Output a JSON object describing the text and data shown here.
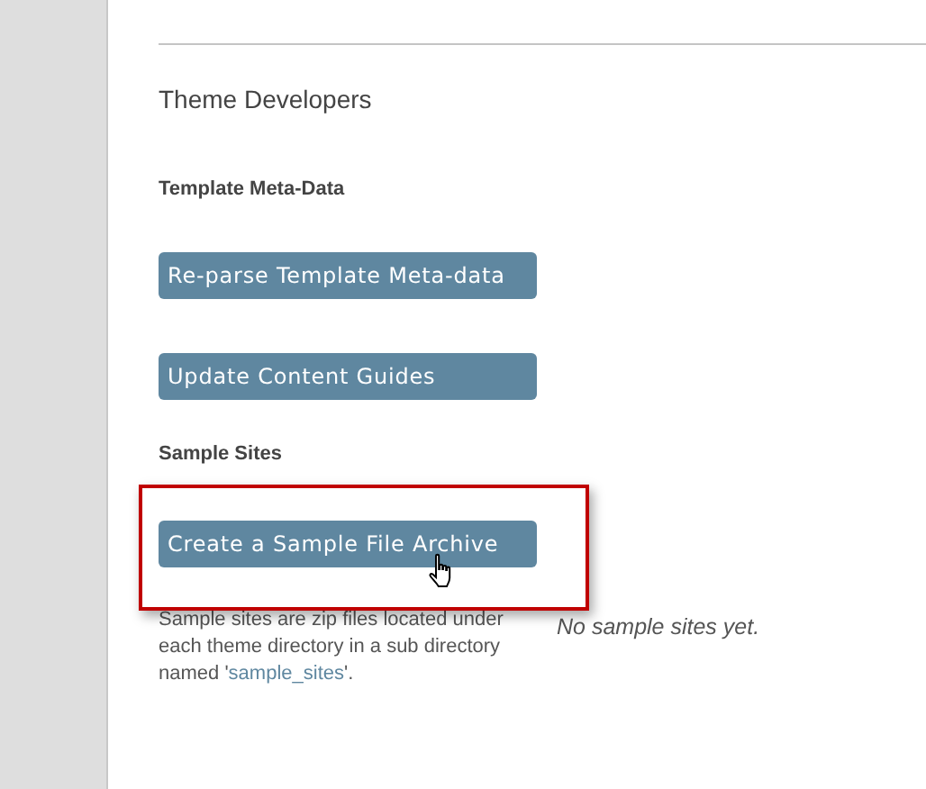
{
  "section_title": "Theme Developers",
  "template_meta": {
    "heading": "Template Meta-Data",
    "buttons": [
      {
        "label": "Re-parse Template Meta-data"
      },
      {
        "label": "Update Content Guides"
      }
    ]
  },
  "sample_sites": {
    "heading": "Sample Sites",
    "button": {
      "label": "Create a Sample File Archive",
      "highlighted": true
    },
    "description": {
      "before": "Sample sites are zip files located under each theme directory in a sub directory named '",
      "link": "sample_sites",
      "after": "'."
    },
    "empty_message": "No sample sites yet."
  }
}
